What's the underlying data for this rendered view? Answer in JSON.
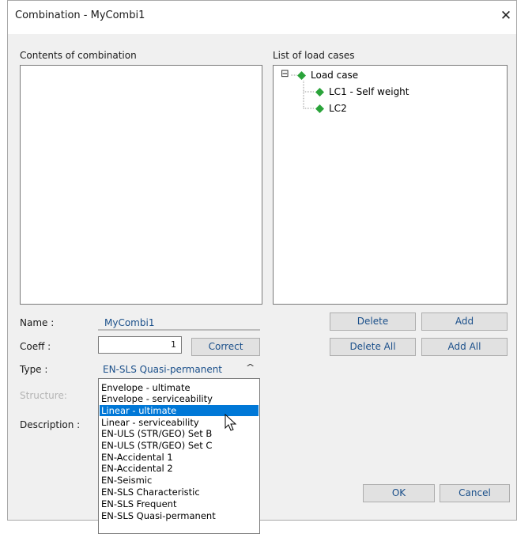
{
  "window": {
    "title": "Combination - MyCombi1",
    "close_glyph": "✕"
  },
  "contents": {
    "label": "Contents of combination"
  },
  "load_cases": {
    "label": "List of load cases",
    "expander_glyph": "⊟",
    "tree": [
      {
        "label": "Load case",
        "icon": "diamond-icon",
        "color": "#2aa33a"
      },
      {
        "label": "LC1 - Self weight",
        "icon": "diamond-icon",
        "color": "#2aa33a"
      },
      {
        "label": "LC2",
        "icon": "diamond-icon",
        "color": "#2aa33a"
      }
    ]
  },
  "buttons": {
    "delete": "Delete",
    "add": "Add",
    "delete_all": "Delete All",
    "add_all": "Add All",
    "correct": "Correct",
    "ok": "OK",
    "cancel": "Cancel"
  },
  "form": {
    "name_label": "Name :",
    "name_value": "MyCombi1",
    "coeff_label": "Coeff :",
    "coeff_value": "1",
    "type_label": "Type :",
    "type_value": "EN-SLS Quasi-permanent",
    "type_caret": "^",
    "structure_label": "Structure:",
    "description_label": "Description :"
  },
  "type_dropdown": {
    "options": [
      "Envelope - ultimate",
      "Envelope - serviceability",
      "Linear - ultimate",
      "Linear - serviceability",
      "EN-ULS (STR/GEO) Set B",
      "EN-ULS (STR/GEO) Set C",
      "EN-Accidental 1",
      "EN-Accidental 2",
      "EN-Seismic",
      "EN-SLS Characteristic",
      "EN-SLS Frequent",
      "EN-SLS Quasi-permanent"
    ],
    "highlighted": "Linear - ultimate",
    "highlight_color": "#0078d7"
  },
  "colors": {
    "accent_text": "#1a4f8a",
    "node_green": "#2aa33a"
  }
}
